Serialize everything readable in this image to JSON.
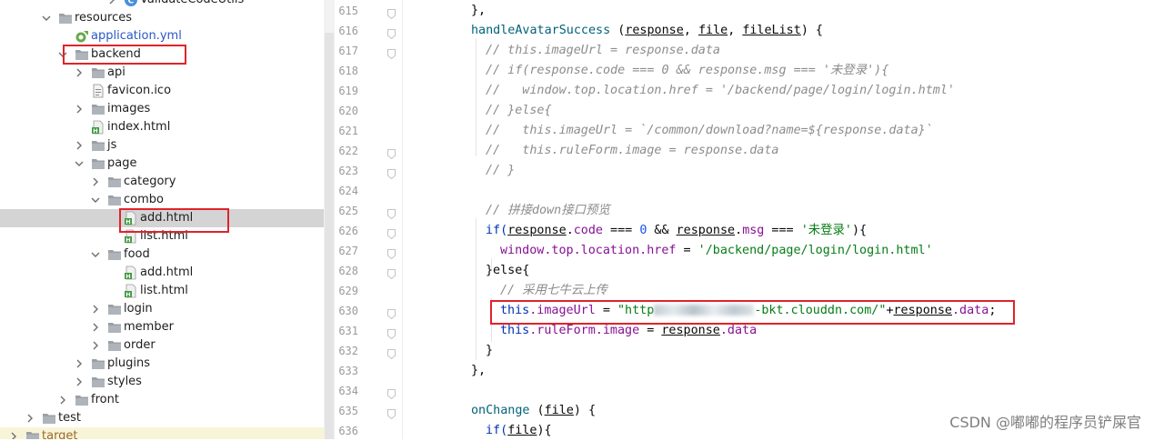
{
  "tree": {
    "rows": [
      {
        "label": "ValidateCodeUtils",
        "icon": "java-class-icon",
        "kind": "class"
      },
      {
        "label": "resources",
        "icon": "resources-folder-icon",
        "kind": "folder"
      },
      {
        "label": "application.yml",
        "icon": "yml-file-icon",
        "kind": "yml"
      },
      {
        "label": "backend",
        "icon": "folder-icon",
        "kind": "folder"
      },
      {
        "label": "api",
        "icon": "folder-icon",
        "kind": "folder"
      },
      {
        "label": "favicon.ico",
        "icon": "file-icon",
        "kind": "file"
      },
      {
        "label": "images",
        "icon": "folder-icon",
        "kind": "folder"
      },
      {
        "label": "index.html",
        "icon": "html-file-icon",
        "kind": "html"
      },
      {
        "label": "js",
        "icon": "folder-icon",
        "kind": "folder"
      },
      {
        "label": "page",
        "icon": "folder-icon",
        "kind": "folder"
      },
      {
        "label": "category",
        "icon": "folder-icon",
        "kind": "folder"
      },
      {
        "label": "combo",
        "icon": "folder-icon",
        "kind": "folder"
      },
      {
        "label": "add.html",
        "icon": "html-file-icon",
        "kind": "html"
      },
      {
        "label": "list.html",
        "icon": "html-file-icon",
        "kind": "html"
      },
      {
        "label": "food",
        "icon": "folder-icon",
        "kind": "folder"
      },
      {
        "label": "add.html",
        "icon": "html-file-icon",
        "kind": "html"
      },
      {
        "label": "list.html",
        "icon": "html-file-icon",
        "kind": "html"
      },
      {
        "label": "login",
        "icon": "folder-icon",
        "kind": "folder"
      },
      {
        "label": "member",
        "icon": "folder-icon",
        "kind": "folder"
      },
      {
        "label": "order",
        "icon": "folder-icon",
        "kind": "folder"
      },
      {
        "label": "plugins",
        "icon": "folder-icon",
        "kind": "folder"
      },
      {
        "label": "styles",
        "icon": "folder-icon",
        "kind": "folder"
      },
      {
        "label": "front",
        "icon": "folder-icon",
        "kind": "folder"
      },
      {
        "label": "test",
        "icon": "folder-icon",
        "kind": "folder"
      },
      {
        "label": "target",
        "icon": "folder-icon",
        "kind": "folder"
      }
    ]
  },
  "editor": {
    "line_numbers": [
      "615",
      "616",
      "617",
      "618",
      "619",
      "620",
      "621",
      "622",
      "623",
      "624",
      "625",
      "626",
      "627",
      "628",
      "629",
      "630",
      "631",
      "632",
      "633",
      "634",
      "635",
      "636"
    ],
    "code": {
      "l615": "},",
      "l616_name": "handleAvatarSuccess",
      "l616_open": " (",
      "l616_p1": "response",
      "l616_c1": ", ",
      "l616_p2": "file",
      "l616_c2": ", ",
      "l616_p3": "fileList",
      "l616_close": ") {",
      "l617": "// this.imageUrl = response.data",
      "l618": "// if(response.code === 0 && response.msg === '未登录'){",
      "l619": "//   window.top.location.href = '/backend/page/login/login.html'",
      "l620": "// }else{",
      "l621": "//   this.imageUrl = `/common/download?name=${response.data}`",
      "l622": "//   this.ruleForm.image = response.data",
      "l623": "// }",
      "l625": "// 拼接down接口预览",
      "l626_if": "if(",
      "l626_resp": "response",
      "l626_dot1": ".",
      "l626_code": "code",
      "l626_eq": " === ",
      "l626_zero": "0",
      "l626_and": " && ",
      "l626_resp2": "response",
      "l626_dot2": ".",
      "l626_msg": "msg",
      "l626_eq2": " === ",
      "l626_str": "'未登录'",
      "l626_end": "){",
      "l627_a": "window.top.location.href",
      "l627_b": " = ",
      "l627_str": "'/backend/page/login/login.html'",
      "l628": "}else{",
      "l629": "// 采用七牛云上传",
      "l630_this": "this",
      "l630_prop": ".imageUrl",
      "l630_eq": " = ",
      "l630_str1": "\"http",
      "l630_str2": "-bkt.clouddn.com/\"",
      "l630_plus": "+",
      "l630_resp": "response",
      "l630_data": ".data",
      "l630_end": ";",
      "l631_this": "this",
      "l631_prop": ".ruleForm.image",
      "l631_eq": " = ",
      "l631_resp": "response",
      "l631_data": ".data",
      "l632": "}",
      "l633": "},",
      "l635_name": "onChange",
      "l635_open": " (",
      "l635_p": "file",
      "l635_close": ") {",
      "l636_if": "if(",
      "l636_p": "file",
      "l636_end": "){"
    }
  },
  "watermark": "CSDN @嘟嘟的程序员铲屎官",
  "colors": {
    "highlight_box": "#e0232a",
    "selected_row": "#d4d4d4",
    "keyword": "#0033b3",
    "function": "#00627a",
    "comment": "#8c8c8c",
    "string": "#067d17",
    "number": "#1750eb",
    "property": "#871094"
  }
}
